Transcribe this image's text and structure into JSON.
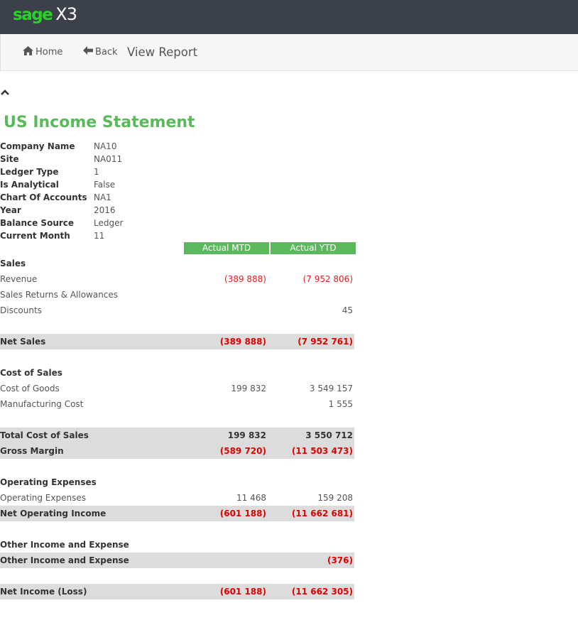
{
  "brand": {
    "sage": "sage",
    "product": "X3"
  },
  "nav": {
    "home": "Home",
    "back": "Back",
    "title": "View Report"
  },
  "report": {
    "title": "US Income Statement",
    "meta": [
      {
        "label": "Company Name",
        "value": "NA10"
      },
      {
        "label": "Site",
        "value": "NA011"
      },
      {
        "label": "Ledger Type",
        "value": "1"
      },
      {
        "label": "Is Analytical",
        "value": "False"
      },
      {
        "label": "Chart Of Accounts",
        "value": "NA1"
      },
      {
        "label": "Year",
        "value": "2016"
      },
      {
        "label": "Balance Source",
        "value": "Ledger"
      },
      {
        "label": "Current Month",
        "value": "11"
      }
    ],
    "columns": {
      "mtd": "Actual MTD",
      "ytd": "Actual YTD"
    },
    "rows": [
      {
        "type": "section",
        "label": "Sales",
        "mtd": "",
        "ytd": ""
      },
      {
        "type": "line",
        "label": "Revenue",
        "mtd": "(389 888)",
        "ytd": "(7 952 806)"
      },
      {
        "type": "line",
        "label": "Sales Returns & Allowances",
        "mtd": "",
        "ytd": ""
      },
      {
        "type": "line",
        "label": "Discounts",
        "mtd": "",
        "ytd": "45"
      },
      {
        "type": "blank",
        "label": "",
        "mtd": "",
        "ytd": ""
      },
      {
        "type": "total",
        "label": "Net Sales",
        "mtd": "(389 888)",
        "ytd": "(7 952 761)"
      },
      {
        "type": "blank",
        "label": "",
        "mtd": "",
        "ytd": ""
      },
      {
        "type": "section",
        "label": "Cost of Sales",
        "mtd": "",
        "ytd": ""
      },
      {
        "type": "line",
        "label": "Cost of Goods",
        "mtd": "199 832",
        "ytd": "3 549 157"
      },
      {
        "type": "line",
        "label": "Manufacturing Cost",
        "mtd": "",
        "ytd": "1 555"
      },
      {
        "type": "blank",
        "label": "",
        "mtd": "",
        "ytd": ""
      },
      {
        "type": "total",
        "label": "Total Cost of Sales",
        "mtd": "199 832",
        "ytd": "3 550 712"
      },
      {
        "type": "total",
        "label": "Gross Margin",
        "mtd": "(589 720)",
        "ytd": "(11 503 473)"
      },
      {
        "type": "blank",
        "label": "",
        "mtd": "",
        "ytd": ""
      },
      {
        "type": "section",
        "label": "Operating Expenses",
        "mtd": "",
        "ytd": ""
      },
      {
        "type": "line",
        "label": "Operating Expenses",
        "mtd": "11 468",
        "ytd": "159 208"
      },
      {
        "type": "total",
        "label": "Net Operating Income",
        "mtd": "(601 188)",
        "ytd": "(11 662 681)"
      },
      {
        "type": "blank",
        "label": "",
        "mtd": "",
        "ytd": ""
      },
      {
        "type": "section",
        "label": "Other Income and Expense",
        "mtd": "",
        "ytd": ""
      },
      {
        "type": "total",
        "label": "Other Income and Expense",
        "mtd": "",
        "ytd": "(376)"
      },
      {
        "type": "blank",
        "label": "",
        "mtd": "",
        "ytd": ""
      },
      {
        "type": "total",
        "label": "Net Income (Loss)",
        "mtd": "(601 188)",
        "ytd": "(11 662 305)"
      }
    ]
  },
  "colors": {
    "topbar": "#3c404a",
    "brand_green": "#2bd12b",
    "accent_green": "#5cb85c",
    "negative": "#e02020",
    "total_bg": "#dcdcdc"
  },
  "icons": {
    "home": "home-icon",
    "back": "arrow-left-icon",
    "collapse": "chevron-up-icon"
  }
}
